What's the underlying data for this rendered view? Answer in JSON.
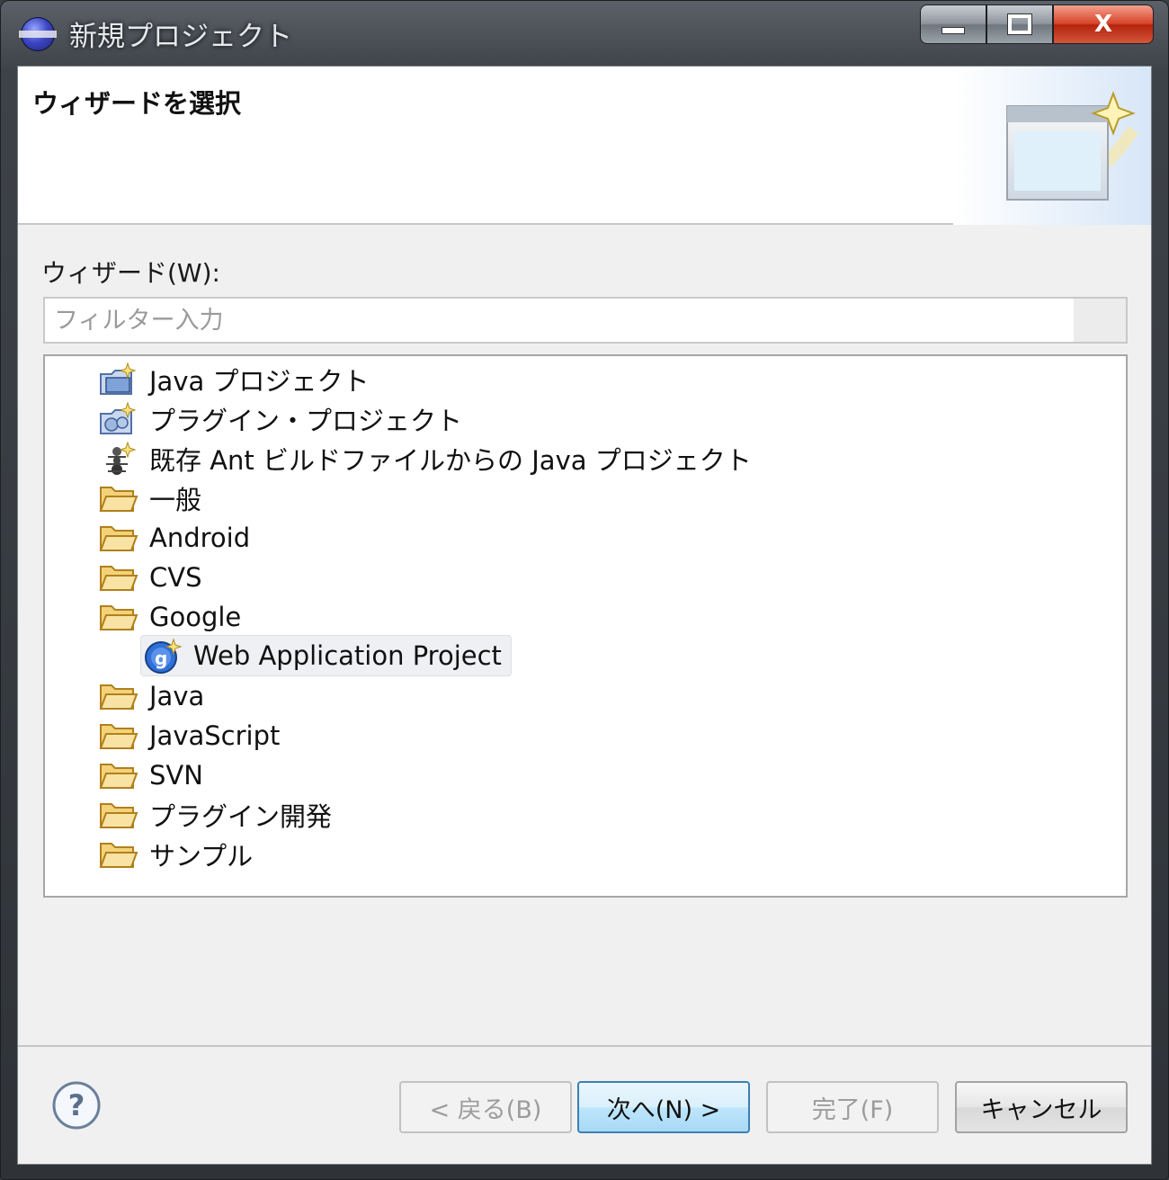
{
  "window": {
    "title": "新規プロジェクト",
    "min_label": "",
    "max_label": "",
    "close_label": "X"
  },
  "banner": {
    "title": "ウィザードを選択"
  },
  "wizards": {
    "label": "ウィザード(W):",
    "filter_placeholder": "フィルター入力",
    "filter_value": "",
    "items": [
      {
        "label": "Java プロジェクト",
        "icon": "java-project-icon"
      },
      {
        "label": "プラグイン・プロジェクト",
        "icon": "plugin-project-icon"
      },
      {
        "label": "既存 Ant ビルドファイルからの Java プロジェクト",
        "icon": "ant-buildfile-icon"
      },
      {
        "label": "一般",
        "icon": "folder-icon"
      },
      {
        "label": "Android",
        "icon": "folder-icon"
      },
      {
        "label": "CVS",
        "icon": "folder-icon"
      },
      {
        "label": "Google",
        "icon": "folder-icon"
      },
      {
        "label": "Web Application Project",
        "icon": "google-web-app-icon",
        "selected": true
      },
      {
        "label": "Java",
        "icon": "folder-icon"
      },
      {
        "label": "JavaScript",
        "icon": "folder-icon"
      },
      {
        "label": "SVN",
        "icon": "folder-icon"
      },
      {
        "label": "プラグイン開発",
        "icon": "folder-icon"
      },
      {
        "label": "サンプル",
        "icon": "folder-icon"
      }
    ]
  },
  "buttons": {
    "help": "?",
    "back": "< 戻る(B)",
    "next": "次へ(N) >",
    "finish": "完了(F)",
    "cancel": "キャンセル"
  },
  "colors": {
    "default_button_border": "#3c7fb1",
    "folder": "#e8b64a",
    "selection_bg": "#eef0f3"
  }
}
